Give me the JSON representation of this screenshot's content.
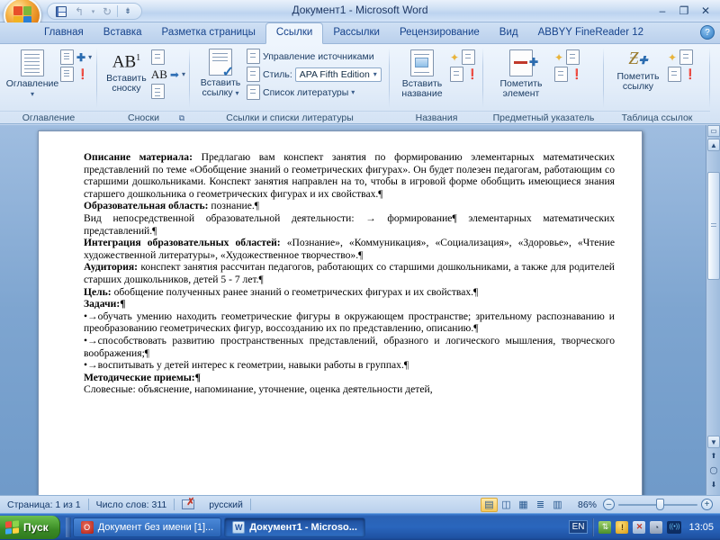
{
  "window": {
    "title": "Документ1 - Microsoft Word",
    "minimize": "–",
    "restore": "❐",
    "close": "✕",
    "office_button": "office-button",
    "quick_access": [
      {
        "name": "save",
        "label": "Сохранить",
        "glyph": "save"
      },
      {
        "name": "undo",
        "label": "Отменить",
        "glyph": "↰"
      },
      {
        "name": "undo-dropdown",
        "label": "",
        "glyph": "▾"
      },
      {
        "name": "redo",
        "label": "Вернуть",
        "glyph": "↻"
      },
      {
        "name": "customize-qat",
        "label": "Настройка панели быстрого доступа",
        "glyph": "⇟"
      }
    ]
  },
  "tabs": [
    {
      "label": "Главная",
      "active": false
    },
    {
      "label": "Вставка",
      "active": false
    },
    {
      "label": "Разметка страницы",
      "active": false
    },
    {
      "label": "Ссылки",
      "active": true
    },
    {
      "label": "Рассылки",
      "active": false
    },
    {
      "label": "Рецензирование",
      "active": false
    },
    {
      "label": "Вид",
      "active": false
    },
    {
      "label": "ABBYY FineReader 12",
      "active": false
    }
  ],
  "help_glyph": "?",
  "ribbon": {
    "groups": [
      {
        "caption": "Оглавление",
        "big_button": {
          "label": "Оглавление",
          "dropdown": "▾"
        },
        "small_buttons": [
          {
            "label": "Добавить текст",
            "dropdown": "▾"
          },
          {
            "label": "Обновить таблицу",
            "dropdown": ""
          }
        ]
      },
      {
        "caption": "Сноски",
        "big_button": {
          "label_line1": "Вставить",
          "label_line2": "сноску",
          "glyph": "AB¹"
        },
        "small_buttons": [
          {
            "label": "Вставить концевую сноску",
            "dropdown": ""
          },
          {
            "label": "Следующая сноска",
            "dropdown": "▾"
          },
          {
            "label": "Показать сноски",
            "dropdown": ""
          }
        ],
        "dialog_launcher": "⧉"
      },
      {
        "caption": "Ссылки и списки литературы",
        "big_button": {
          "label_line1": "Вставить",
          "label_line2": "ссылку",
          "dropdown": "▾"
        },
        "rows": [
          {
            "label": "Управление источниками"
          },
          {
            "label": "Стиль:",
            "select_value": "APA Fifth Edition",
            "dropdown": "▾"
          },
          {
            "label": "Список литературы",
            "dropdown": "▾"
          }
        ]
      },
      {
        "caption": "Названия",
        "big_button": {
          "label_line1": "Вставить",
          "label_line2": "название"
        },
        "small_buttons": [
          {
            "label": "Вставить список иллюстраций"
          },
          {
            "label": "Обновить таблицу"
          },
          {
            "label": "Перекрёстная ссылка"
          }
        ]
      },
      {
        "caption": "Предметный указатель",
        "big_button": {
          "label_line1": "Пометить",
          "label_line2": "элемент"
        },
        "small_buttons": [
          {
            "label": "Предметный указатель"
          },
          {
            "label": "Обновить указатель"
          }
        ]
      },
      {
        "caption": "Таблица ссылок",
        "big_button": {
          "label_line1": "Пометить",
          "label_line2": "ссылку"
        },
        "small_buttons": [
          {
            "label": "Таблица ссылок"
          },
          {
            "label": "Обновить таблицу"
          }
        ]
      }
    ]
  },
  "document": {
    "paragraphs": [
      {
        "type": "indented",
        "runs": [
          {
            "text": "Описание материала:",
            "bold": true
          },
          {
            "text": " Предлагаю вам конспект занятия по формированию элементарных математических представлений по теме «Обобщение знаний о геометрических фигурах». Он будет полезен педагогам, работающим со старшими дошкольниками. Конспект занятия направлен на то, чтобы в игровой форме обобщить имеющиеся знания старшего дошкольника о геометрических фигурах и их свойствах.¶",
            "bold": false
          }
        ]
      },
      {
        "type": "indented",
        "runs": [
          {
            "text": "Образовательная область:",
            "bold": true
          },
          {
            "text": " познание.¶",
            "bold": false
          }
        ]
      },
      {
        "type": "indented",
        "runs": [
          {
            "text": "Вид непосредственной образовательной деятельности:  →  формирование¶ элементарных математических представлений.¶",
            "bold": false
          }
        ]
      },
      {
        "type": "indented",
        "runs": [
          {
            "text": "Интеграция образовательных областей:",
            "bold": true
          },
          {
            "text": " «Познание», «Коммуникация», «Социализация», «Здоровье», «Чтение художественной литературы», «Художественное творчество».¶",
            "bold": false
          }
        ]
      },
      {
        "type": "indented",
        "runs": [
          {
            "text": "Аудитория:",
            "bold": true
          },
          {
            "text": " конспект занятия рассчитан педагогов, работающих со старшими дошкольниками, а также для родителей старших дошкольников, детей 5 - 7 лет.¶",
            "bold": false
          }
        ]
      },
      {
        "type": "indented",
        "runs": [
          {
            "text": "Цель:",
            "bold": true
          },
          {
            "text": " обобщение полученных ранее знаний о геометрических фигурах и их свойствах.¶",
            "bold": false
          }
        ]
      },
      {
        "type": "indented",
        "runs": [
          {
            "text": "Задачи:¶",
            "bold": true
          }
        ]
      },
      {
        "type": "indented",
        "runs": [
          {
            "text": "•→обучать умению находить геометрические фигуры в окружающем пространстве; зрительному распознаванию и преобразованию геометрических фигур, воссозданию их по представлению, описанию.¶",
            "bold": false
          }
        ]
      },
      {
        "type": "indented",
        "runs": [
          {
            "text": "•→способствовать развитию пространственных представлений, образного и логического мышления, творческого воображения;¶",
            "bold": false
          }
        ]
      },
      {
        "type": "indented",
        "runs": [
          {
            "text": "•→воспитывать у детей интерес к геометрии, навыки работы в группах.¶",
            "bold": false
          }
        ]
      },
      {
        "type": "indented",
        "runs": [
          {
            "text": "Методические приемы:¶",
            "bold": true
          }
        ]
      },
      {
        "type": "plain",
        "runs": [
          {
            "text": "Словесные: объяснение, напоминание, уточнение, оценка деятельности детей,",
            "bold": false
          }
        ]
      }
    ]
  },
  "scrollbar": {
    "split_glyph": "▭",
    "up_glyph": "▲",
    "down_glyph": "▼",
    "prev_page_glyph": "⬆",
    "select_object_glyph": "◯",
    "next_page_glyph": "⬇"
  },
  "status_bar": {
    "page_info": "Страница: 1 из 1",
    "word_count": "Число слов: 311",
    "proofing_icon": "spellcheck-icon",
    "language": "русский",
    "view_buttons": [
      {
        "name": "print-layout",
        "glyph": "▤",
        "selected": true
      },
      {
        "name": "full-screen-reading",
        "glyph": "◫",
        "selected": false
      },
      {
        "name": "web-layout",
        "glyph": "▦",
        "selected": false
      },
      {
        "name": "outline",
        "glyph": "≣",
        "selected": false
      },
      {
        "name": "draft",
        "glyph": "▥",
        "selected": false
      }
    ],
    "zoom_level": "86%",
    "zoom_out": "–",
    "zoom_in": "+"
  },
  "taskbar": {
    "start_label": "Пуск",
    "buttons": [
      {
        "label": "Документ без имени [1]...",
        "icon": "opera-icon",
        "active": false
      },
      {
        "label": "Документ1 - Microso...",
        "icon": "word-icon",
        "active": true
      }
    ],
    "tray": {
      "language": "EN",
      "icons": [
        {
          "name": "network-activity-icon",
          "glyph": "🖧"
        },
        {
          "name": "warning-shield-icon",
          "glyph": "!"
        },
        {
          "name": "network-disconnected-icon",
          "glyph": "✕"
        },
        {
          "name": "safely-remove-icon",
          "glyph": "◔"
        },
        {
          "name": "wireless-icon",
          "glyph": "((•))"
        }
      ],
      "clock": "13:05"
    }
  }
}
